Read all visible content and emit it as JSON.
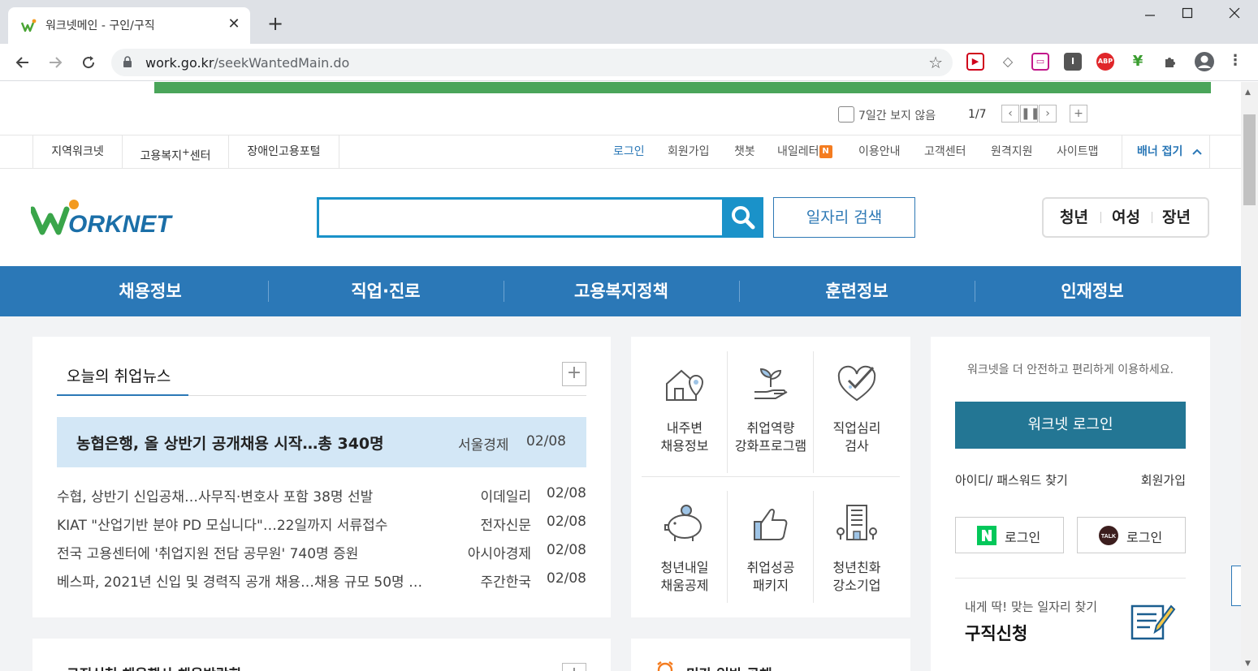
{
  "browser": {
    "tab_title": "워크넷메인 - 구인/구직",
    "url_host": "work.go.kr",
    "url_path": "/seekWantedMain.do",
    "extensions": [
      "video-ext-icon",
      "tag-ext-icon",
      "screen-ext-icon",
      "reader-ext-icon",
      "adblock-icon",
      "feather-ext-icon",
      "puzzle-icon",
      "profile-icon"
    ],
    "adblock_label": "ABP"
  },
  "banner": {
    "hide_label": "7일간 보지 않음",
    "page": "1/7"
  },
  "util": {
    "left_links": [
      "지역워크넷",
      "고용복지",
      "장애인고용포털"
    ],
    "welfare_sup": "+",
    "welfare_suffix": "센터",
    "right_links": [
      "로그인",
      "회원가입",
      "챗봇",
      "내일레터",
      "이용안내",
      "고객센터",
      "원격지원",
      "사이트맵"
    ],
    "n_badge": "N",
    "banner_fold": "배너 접기"
  },
  "header": {
    "logo_text": "ORKNET",
    "search_placeholder": "",
    "job_search_label": "일자리 검색",
    "age_tabs": [
      "청년",
      "여성",
      "장년"
    ]
  },
  "gnb": [
    "채용정보",
    "직업·진로",
    "고용복지정책",
    "훈련정보",
    "인재정보"
  ],
  "news": {
    "title": "오늘의 취업뉴스",
    "headline": {
      "title": "농협은행, 올 상반기 공개채용 시작…총 340명",
      "source": "서울경제",
      "date": "02/08"
    },
    "items": [
      {
        "title": "수협, 상반기 신입공채…사무직·변호사 포함 38명 선발",
        "source": "이데일리",
        "date": "02/08"
      },
      {
        "title": "KIAT \"산업기반 분야 PD 모십니다\"…22일까지 서류접수",
        "source": "전자신문",
        "date": "02/08"
      },
      {
        "title": "전국 고용센터에 '취업지원 전담 공무원' 740명 증원",
        "source": "아시아경제",
        "date": "02/08"
      },
      {
        "title": "베스파, 2021년 신입 및 경력직 공개 채용…채용 규모 50명 …",
        "source": "주간한국",
        "date": "02/08"
      }
    ]
  },
  "services": [
    {
      "line1": "내주변",
      "line2": "채용정보",
      "icon": "house-location-icon"
    },
    {
      "line1": "취업역량",
      "line2": "강화프로그램",
      "icon": "sprout-hand-icon"
    },
    {
      "line1": "직업심리",
      "line2": "검사",
      "icon": "heart-check-icon"
    },
    {
      "line1": "청년내일",
      "line2": "채움공제",
      "icon": "piggy-bank-icon"
    },
    {
      "line1": "취업성공",
      "line2": "패키지",
      "icon": "thumbs-up-icon"
    },
    {
      "line1": "청년친화",
      "line2": "강소기업",
      "icon": "building-icon"
    }
  ],
  "login": {
    "notice": "워크넷을 더 안전하고 편리하게 이용하세요.",
    "button": "워크넷 로그인",
    "find": "아이디/ 패스워드 찾기",
    "join": "회원가입",
    "naver": "로그인",
    "kakao": "로그인",
    "kakao_badge": "TALK",
    "apply_sub": "내게 딱! 맞는 일자리 찾기",
    "apply_title": "구직신청"
  },
  "lower": {
    "left_partial": "구직신청    채용행사    채용박람회",
    "mid_partial": "민간 일반 공채"
  },
  "colors": {
    "primary": "#2b78b7",
    "search": "#1a92c9",
    "login": "#237694",
    "headline_bg": "#d3e7f6",
    "naver": "#03c75a"
  }
}
